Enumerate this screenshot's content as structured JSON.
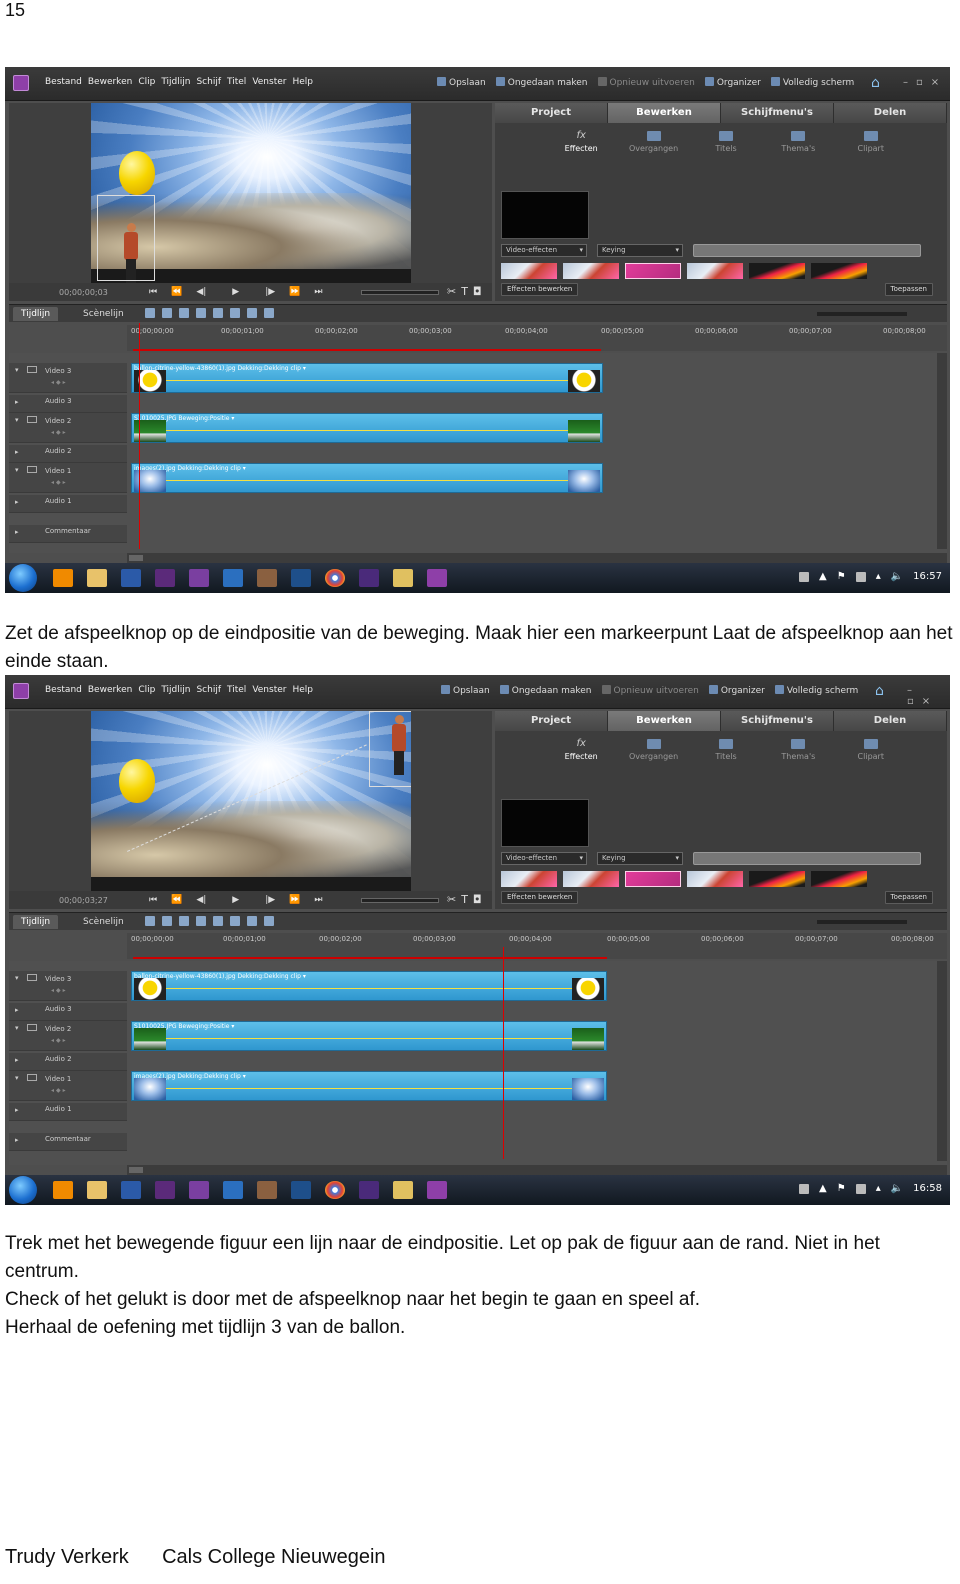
{
  "page_number": "15",
  "paragraph1": "Zet de afspeelknop op de eindpositie van de beweging. Maak hier een markeerpunt Laat de afspeelknop aan het einde staan.",
  "paragraph2": [
    "Trek met het bewegende figuur een lijn naar de eindpositie. Let op pak de figuur aan de rand. Niet in het centrum.",
    "Check of het gelukt is door met de afspeelknop naar het begin te gaan en speel af.",
    "Herhaal de oefening met tijdlijn 3 van de ballon."
  ],
  "footer": {
    "author": "Trudy Verkerk",
    "school": "Cals College Nieuwegein"
  },
  "app": {
    "menu": [
      "Bestand",
      "Bewerken",
      "Clip",
      "Tijdlijn",
      "Schijf",
      "Titel",
      "Venster",
      "Help"
    ],
    "toolbar": {
      "save": "Opslaan",
      "undo": "Ongedaan maken",
      "redo": "Opnieuw uitvoeren",
      "organizer": "Organizer",
      "fullscreen": "Volledig scherm"
    },
    "panel_tabs": [
      "Project",
      "Bewerken",
      "Schijfmenu's",
      "Delen"
    ],
    "active_panel_tab": "Bewerken",
    "subtabs": [
      "Effecten",
      "Overgangen",
      "Titels",
      "Thema's",
      "Clipart"
    ],
    "fx_glyph": "fx",
    "dropdown_category": "Video-effecten",
    "dropdown_filter": "Keying",
    "edit_effects_button": "Effecten bewerken",
    "apply_button": "Toepassen",
    "timeline_tabs": [
      "Tijdlijn",
      "Scènelijn"
    ],
    "ruler_ticks": [
      "00;00;00;00",
      "00;00;01;00",
      "00;00;02;00",
      "00;00;03;00",
      "00;00;04;00",
      "00;00;05;00",
      "00;00;06;00",
      "00;00;07;00",
      "00;00;08;00"
    ],
    "track_labels": [
      "Video 3",
      "Audio 3",
      "Video 2",
      "Audio 2",
      "Video 1",
      "Audio 1",
      "Commentaar"
    ],
    "clips": {
      "video3": "ballon-citrine-yellow-43860(1).jpg  Dekking:Dekking clip ▾",
      "video2": "S1010025.JPG  Beweging:Positie ▾",
      "video1": "images(2).jpg  Dekking:Dekking clip ▾"
    }
  },
  "screenshots": [
    {
      "timecode": "00;00;00;03",
      "clock": "16:57",
      "ruler_first": "00;00;00;00",
      "ruler_fifth": "00;00;05;00"
    },
    {
      "timecode": "00;00;03;27",
      "clock": "16:58",
      "ruler_first": "00;00;00;00",
      "ruler_fifth": "00;00;05;00"
    }
  ],
  "colors": {
    "panel_bg": "#4e4e4e",
    "clip_blue": "#3aa5da",
    "accent_red": "#dd0000"
  }
}
